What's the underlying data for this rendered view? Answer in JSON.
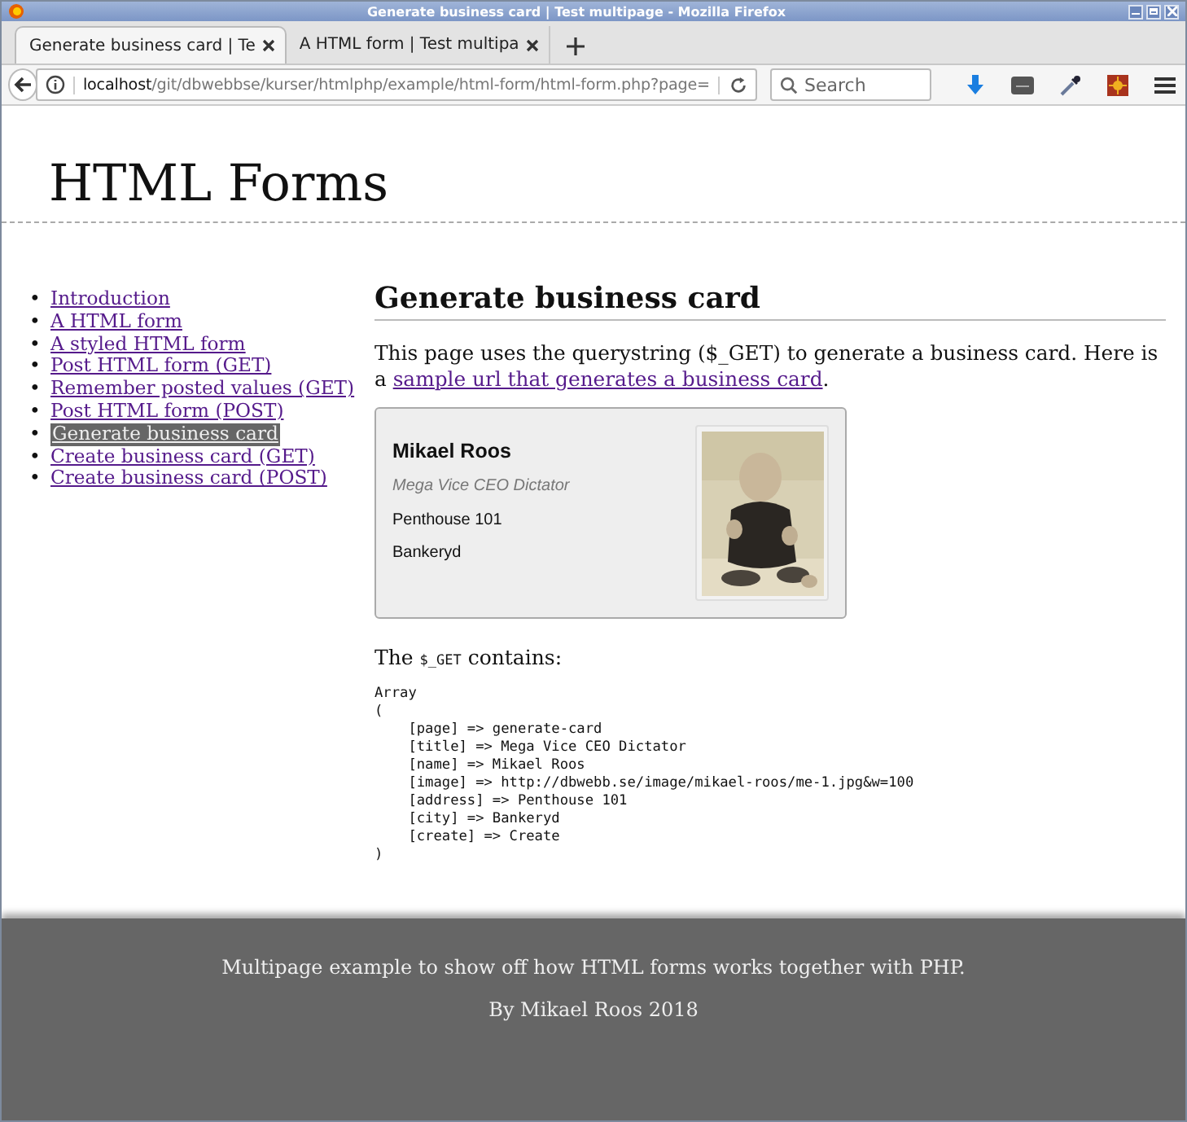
{
  "window": {
    "title": "Generate business card | Test multipage - Mozilla Firefox"
  },
  "tabs": [
    {
      "label": "Generate business card | Te",
      "selected": true
    },
    {
      "label": "A HTML form | Test multipa",
      "selected": false
    }
  ],
  "address_bar": {
    "host": "localhost",
    "path": "/git/dbwebbse/kurser/htmlphp/example/html-form/html-form.php?page="
  },
  "search": {
    "placeholder": "Search"
  },
  "page": {
    "heading": "HTML Forms",
    "nav": [
      {
        "marker": "•",
        "label": "Introduction",
        "selected": false
      },
      {
        "marker": "•",
        "label": "A HTML form",
        "selected": false
      },
      {
        "marker": "•",
        "label": "A styled HTML form",
        "selected": false
      },
      {
        "marker": "•",
        "label": "Post HTML form (GET)",
        "selected": false
      },
      {
        "marker": "•",
        "label": "Remember posted values (GET)",
        "selected": false
      },
      {
        "marker": "•",
        "label": "Post HTML form (POST)",
        "selected": false
      },
      {
        "marker": "•",
        "label": "Generate business card",
        "selected": true
      },
      {
        "marker": "•",
        "label": "Create business card (GET)",
        "selected": false
      },
      {
        "marker": "•",
        "label": "Create business card (POST)",
        "selected": false
      }
    ],
    "title": "Generate business card",
    "intro": {
      "text": "This page uses the querystring ($_GET) to generate a business card. Here is a ",
      "link": "sample url that generates a business card",
      "after": "."
    },
    "card": {
      "name": "Mikael Roos",
      "job_title": "Mega Vice CEO Dictator",
      "address": "Penthouse 101",
      "city": "Bankeryd"
    },
    "get_label": {
      "before": "The ",
      "code": "$_GET",
      "after": " contains:"
    },
    "dump": [
      "Array",
      "(",
      "    [page] => generate-card",
      "    [title] => Mega Vice CEO Dictator",
      "    [name] => Mikael Roos",
      "    [image] => http://dbwebb.se/image/mikael-roos/me-1.jpg&w=100",
      "    [address] => Penthouse 101",
      "    [city] => Bankeryd",
      "    [create] => Create",
      ")"
    ],
    "footer": [
      "Multipage example to show off how HTML forms works together with PHP.",
      "By Mikael Roos 2018"
    ]
  }
}
